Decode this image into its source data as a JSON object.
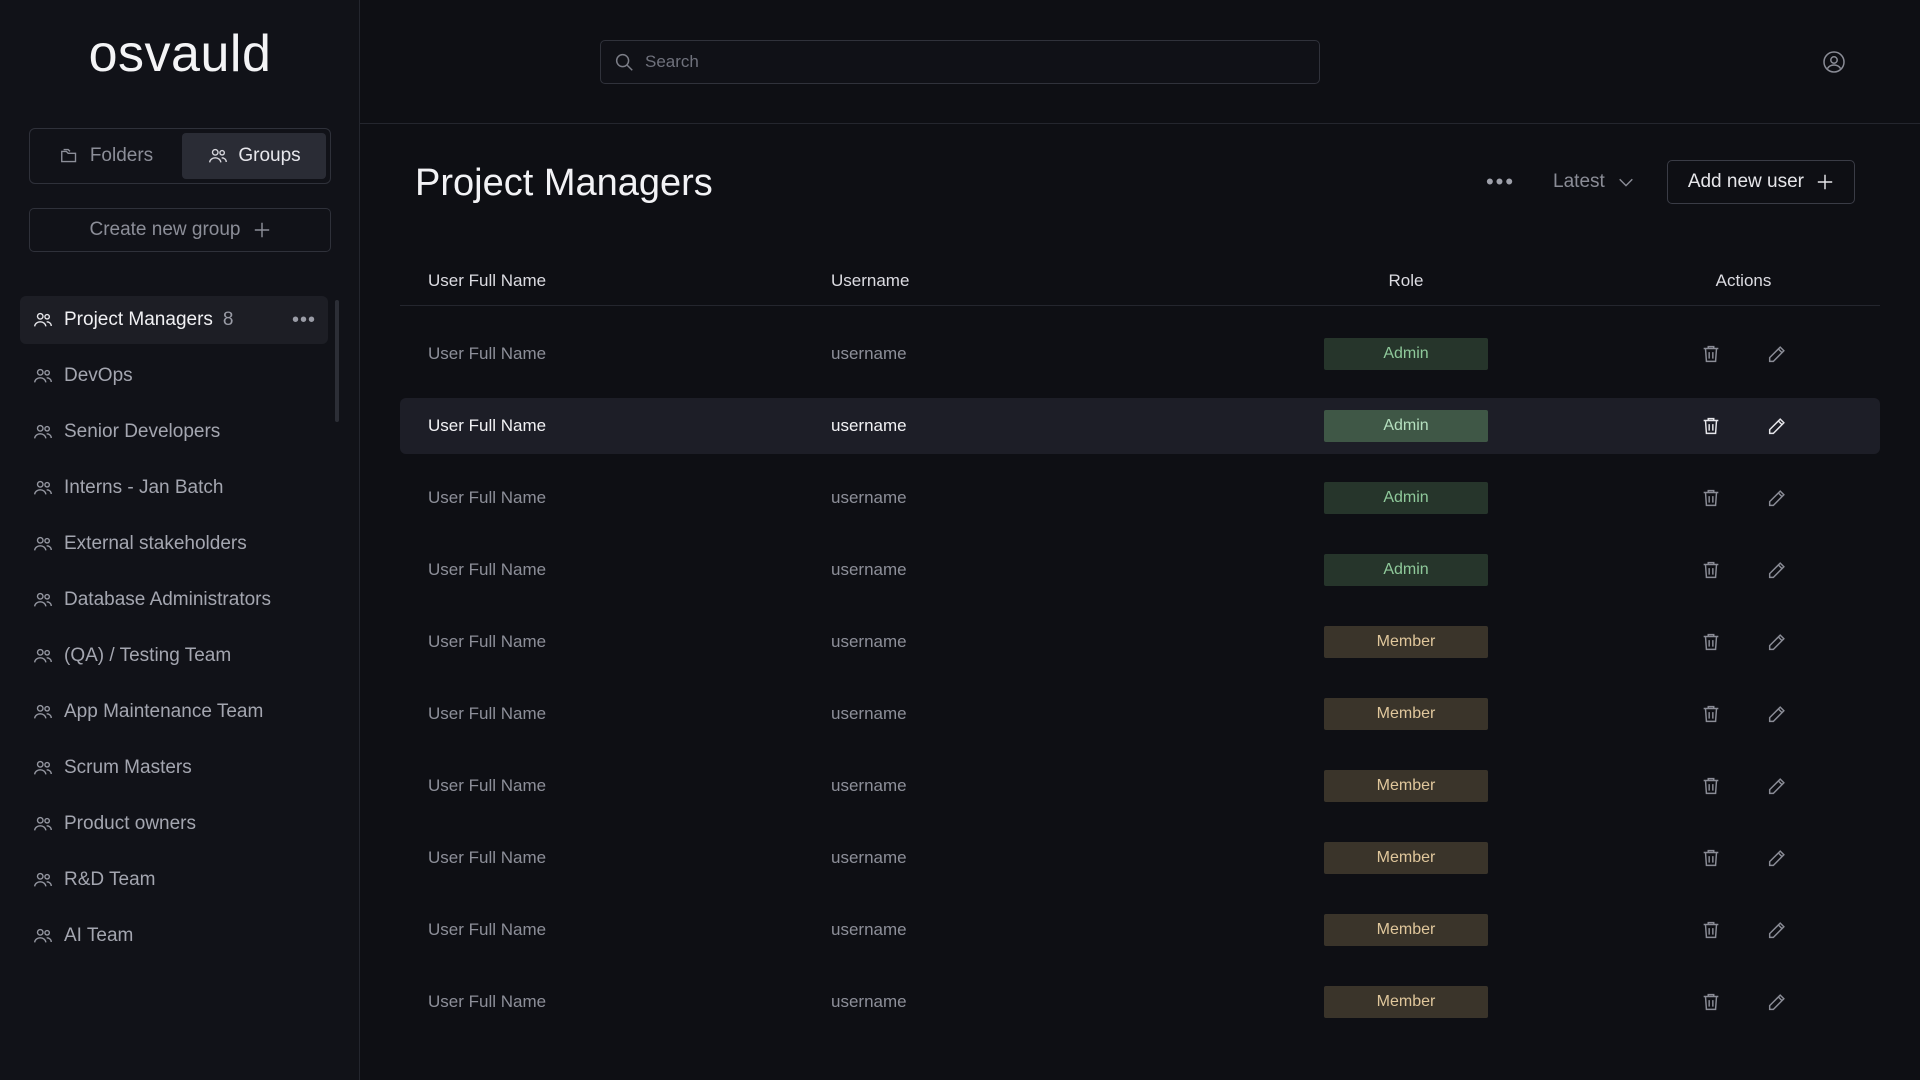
{
  "brand": {
    "name": "osvauld"
  },
  "sidebar": {
    "tabs": [
      {
        "label": "Folders",
        "icon": "folder-icon",
        "active": false
      },
      {
        "label": "Groups",
        "icon": "users-icon",
        "active": true
      }
    ],
    "create_group_label": "Create new group",
    "groups": [
      {
        "label": "Project Managers",
        "count": "8",
        "active": true
      },
      {
        "label": "DevOps"
      },
      {
        "label": "Senior Developers"
      },
      {
        "label": "Interns - Jan Batch"
      },
      {
        "label": "External stakeholders"
      },
      {
        "label": "Database Administrators"
      },
      {
        "label": "(QA) / Testing Team"
      },
      {
        "label": "App Maintenance Team"
      },
      {
        "label": "Scrum Masters"
      },
      {
        "label": "Product owners"
      },
      {
        "label": "R&D Team"
      },
      {
        "label": "AI Team"
      }
    ]
  },
  "search": {
    "placeholder": "Search",
    "value": ""
  },
  "main": {
    "title": "Project Managers",
    "sort_label": "Latest",
    "add_user_label": "Add new user"
  },
  "table": {
    "headers": [
      "User Full Name",
      "Username",
      "Role",
      "Actions"
    ],
    "rows": [
      {
        "name": "User Full Name",
        "username": "username",
        "role": "Admin",
        "highlighted": false
      },
      {
        "name": "User Full Name",
        "username": "username",
        "role": "Admin",
        "highlighted": true
      },
      {
        "name": "User Full Name",
        "username": "username",
        "role": "Admin",
        "highlighted": false
      },
      {
        "name": "User Full Name",
        "username": "username",
        "role": "Admin",
        "highlighted": false
      },
      {
        "name": "User Full Name",
        "username": "username",
        "role": "Member",
        "highlighted": false
      },
      {
        "name": "User Full Name",
        "username": "username",
        "role": "Member",
        "highlighted": false
      },
      {
        "name": "User Full Name",
        "username": "username",
        "role": "Member",
        "highlighted": false
      },
      {
        "name": "User Full Name",
        "username": "username",
        "role": "Member",
        "highlighted": false
      },
      {
        "name": "User Full Name",
        "username": "username",
        "role": "Member",
        "highlighted": false
      },
      {
        "name": "User Full Name",
        "username": "username",
        "role": "Member",
        "highlighted": false
      }
    ]
  },
  "colors": {
    "background": "#0e0f14",
    "sidebar": "#111218",
    "admin_badge": "#26352b",
    "member_badge": "#3a342a"
  }
}
